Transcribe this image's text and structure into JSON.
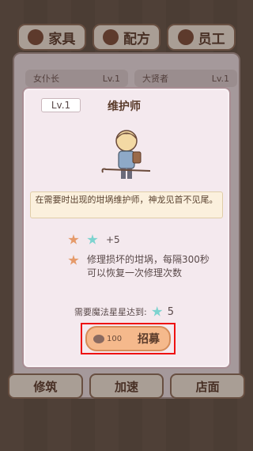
{
  "tabs": [
    {
      "label": "家具"
    },
    {
      "label": "配方"
    },
    {
      "label": "员工"
    }
  ],
  "under": {
    "left_slot": {
      "name": "女仆长",
      "level": "Lv.1"
    },
    "right_slot": {
      "name": "大贤者",
      "level": "Lv.1"
    }
  },
  "modal": {
    "level": "Lv.1",
    "name": "维护师",
    "description": "在需要时出现的坩埚维护师，神龙见首不见尾。",
    "bonus": "+5",
    "effect": "修理损坏的坩埚，每隔300秒可以恢复一次修理次数",
    "requirement": "需要魔法星星达到:",
    "requirement_value": "5",
    "recruit": {
      "cost": "100",
      "label": "招募"
    }
  },
  "bottom": [
    {
      "label": "修筑"
    },
    {
      "label": "加速"
    },
    {
      "label": "店面"
    }
  ],
  "colors": {
    "highlight": "#ee1111",
    "button": "#f5b98c"
  }
}
